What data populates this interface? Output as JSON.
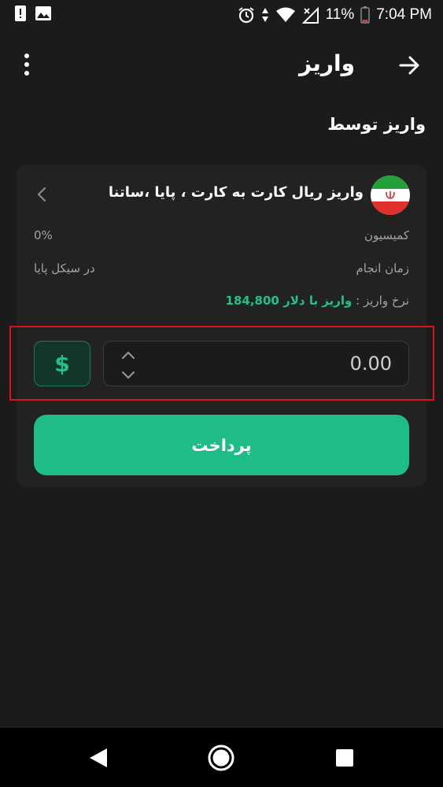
{
  "status_bar": {
    "battery_percent": "11%",
    "time": "7:04 PM",
    "icons": [
      "alert-icon",
      "image-icon",
      "alarm-icon",
      "data-arrows-icon",
      "wifi-icon",
      "signal-icon",
      "battery-icon"
    ]
  },
  "header": {
    "title": "واریز",
    "icons": [
      "more-vertical-icon",
      "arrow-right-icon"
    ]
  },
  "section": {
    "title": "واریز توسط"
  },
  "method": {
    "title": "واریز ریال کارت به کارت ،  پایا ،ساتنا",
    "flag": "iran-flag-icon",
    "rows": [
      {
        "label": "کمیسیون",
        "value": "0%"
      },
      {
        "label": "زمان انجام",
        "value": "در سیکل پایا"
      }
    ],
    "rate": {
      "label": "نرخ واریز :",
      "value": "واریز با دلار 184,800"
    }
  },
  "amount": {
    "currency_symbol": "$",
    "value": "0.00"
  },
  "pay_button": {
    "label": "پرداخت"
  },
  "colors": {
    "background": "#1b1b1b",
    "card": "#222222",
    "accent": "#1ebd86",
    "highlight": "#d5151b"
  }
}
